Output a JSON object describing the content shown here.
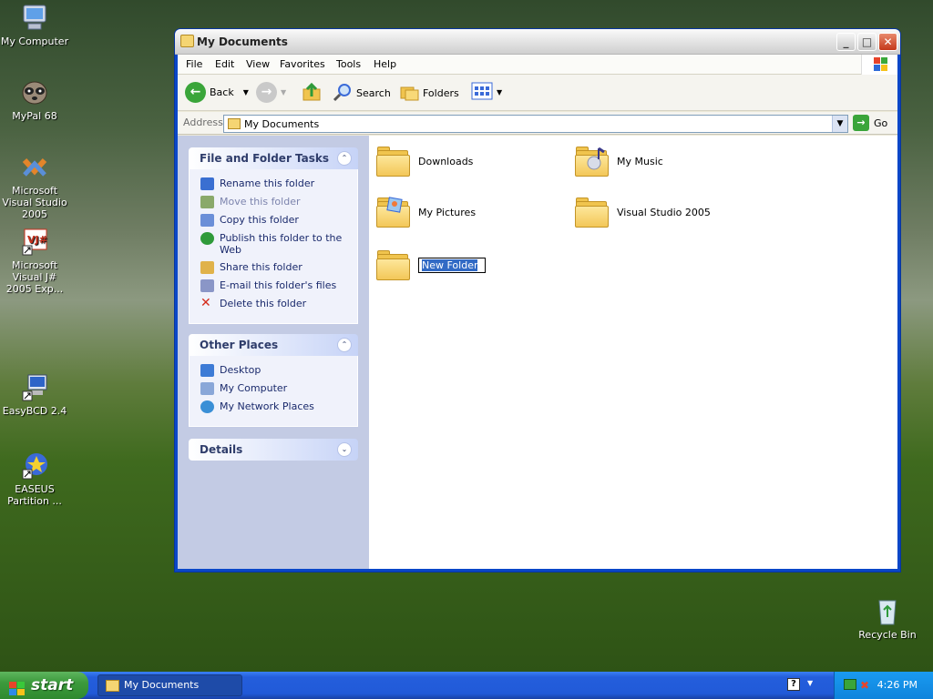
{
  "desktop": {
    "icons": [
      {
        "label": "My Computer",
        "icon": "computer-icon"
      },
      {
        "label": "MyPal 68",
        "icon": "raccoon-icon"
      },
      {
        "label": "Microsoft Visual Studio 2005",
        "icon": "visual-studio-icon"
      },
      {
        "label": "Microsoft Visual J# 2005 Exp...",
        "icon": "vj-icon"
      },
      {
        "label": "EasyBCD 2.4",
        "icon": "easybcd-icon"
      },
      {
        "label": "EASEUS Partition ...",
        "icon": "easeus-icon"
      },
      {
        "label": "Recycle Bin",
        "icon": "recycle-bin-icon"
      }
    ]
  },
  "window": {
    "title": "My Documents",
    "buttons": {
      "minimize": "_",
      "maximize": "□",
      "close": "✕"
    },
    "menu": [
      "File",
      "Edit",
      "View",
      "Favorites",
      "Tools",
      "Help"
    ],
    "toolbar": {
      "back": "Back",
      "search": "Search",
      "folders": "Folders"
    },
    "address": {
      "label": "Address",
      "value": "My Documents",
      "go": "Go"
    }
  },
  "tasks": {
    "file_folder": {
      "title": "File and Folder Tasks",
      "items": [
        {
          "label": "Rename this folder",
          "icon": "rename-icon",
          "color": "#3a6fd1"
        },
        {
          "label": "Move this folder",
          "icon": "move-icon",
          "color": "#8aa96a"
        },
        {
          "label": "Copy this folder",
          "icon": "copy-icon",
          "color": "#6b8fd8"
        },
        {
          "label": "Publish this folder to the Web",
          "icon": "globe-icon",
          "color": "#2f9a3a"
        },
        {
          "label": "Share this folder",
          "icon": "share-icon",
          "color": "#e0b24a"
        },
        {
          "label": "E-mail this folder's files",
          "icon": "email-icon",
          "color": "#8a96c7"
        },
        {
          "label": "Delete this folder",
          "icon": "delete-icon",
          "color": "#d42a1a"
        }
      ]
    },
    "other_places": {
      "title": "Other Places",
      "items": [
        {
          "label": "Desktop",
          "icon": "desktop-icon",
          "color": "#3d7bd6"
        },
        {
          "label": "My Computer",
          "icon": "computer-icon",
          "color": "#8aa7d8"
        },
        {
          "label": "My Network Places",
          "icon": "network-icon",
          "color": "#3a8fd6"
        }
      ]
    },
    "details": {
      "title": "Details"
    }
  },
  "folders": [
    {
      "name": "Downloads",
      "icon": "folder-icon"
    },
    {
      "name": "My Music",
      "icon": "music-folder-icon"
    },
    {
      "name": "My Pictures",
      "icon": "pictures-folder-icon"
    },
    {
      "name": "Visual Studio 2005",
      "icon": "folder-icon"
    },
    {
      "name": "New Folder",
      "icon": "folder-icon",
      "renaming": true
    }
  ],
  "taskbar": {
    "start": "start",
    "task": "My Documents",
    "clock": "4:26 PM"
  }
}
